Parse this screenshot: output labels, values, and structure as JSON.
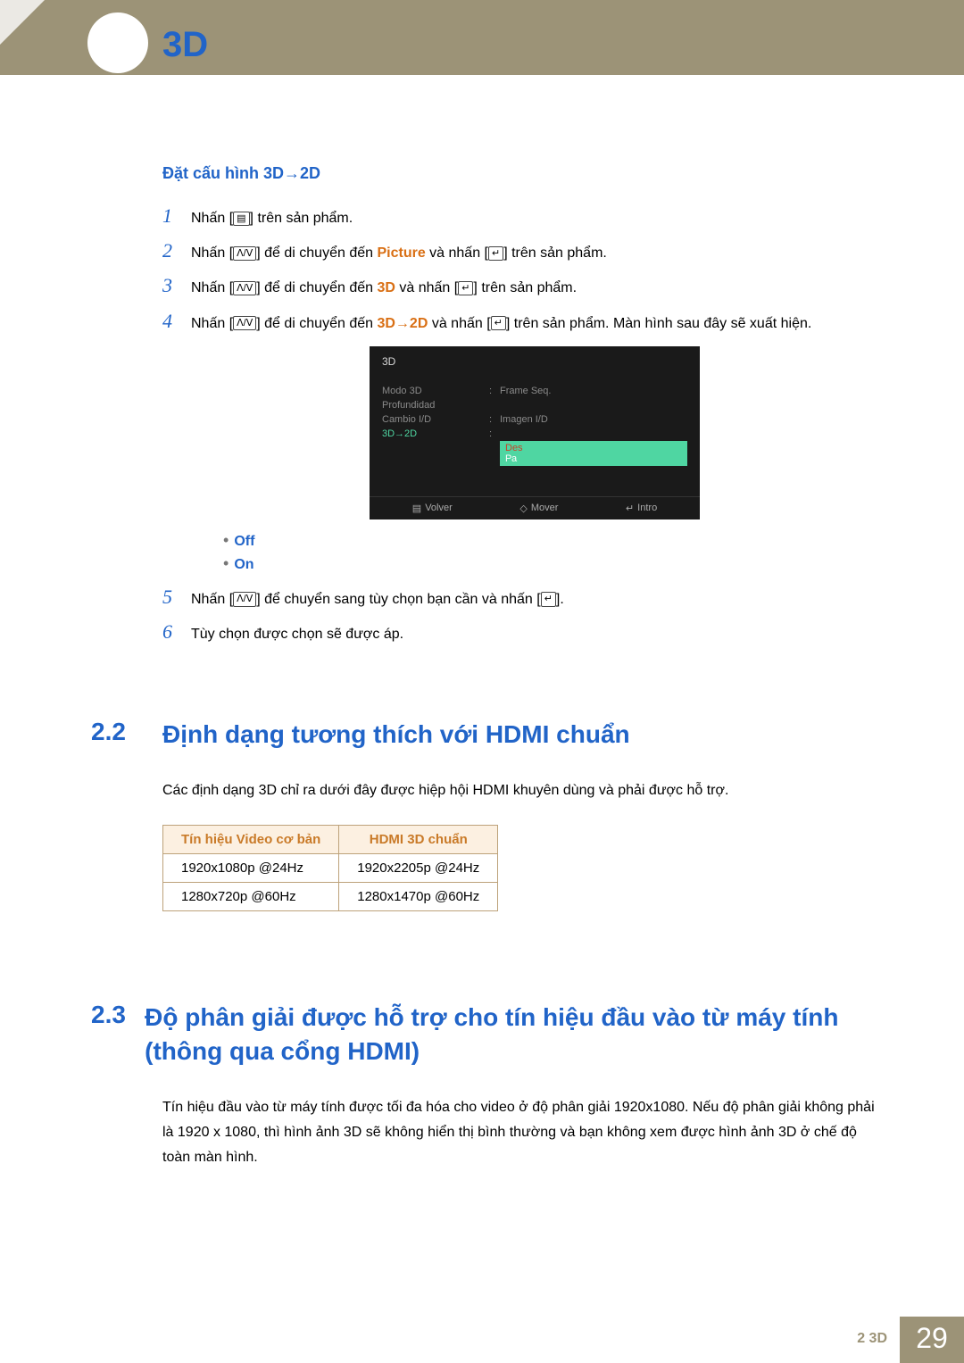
{
  "header": {
    "title": "3D"
  },
  "subhead": "Đặt cấu hình 3D→2D",
  "steps": {
    "s1": {
      "text_a": "Nhấn [",
      "text_b": "] trên sản phẩm."
    },
    "s2": {
      "text_a": "Nhấn [",
      "text_b": "] để di chuyển đến ",
      "kw": "Picture",
      "text_c": " và nhấn [",
      "text_d": "] trên sản phẩm."
    },
    "s3": {
      "text_a": "Nhấn [",
      "text_b": "] để di chuyển đến ",
      "kw": "3D",
      "text_c": " và nhấn [",
      "text_d": "] trên sản phẩm."
    },
    "s4": {
      "text_a": "Nhấn [",
      "text_b": "] để di chuyển đến ",
      "kw": "3D→2D",
      "text_c": " và nhấn [",
      "text_d": "] trên sản phẩm. Màn hình sau đây sẽ xuất hiện."
    },
    "s5": {
      "text_a": "Nhấn [",
      "text_b": "] để chuyển sang tùy chọn bạn cần và nhấn [",
      "text_c": "]."
    },
    "s6": {
      "text": "Tùy chọn được chọn sẽ được áp."
    }
  },
  "osd": {
    "title": "3D",
    "rows": {
      "r1": {
        "label": "Modo 3D",
        "value": "Frame Seq."
      },
      "r2": {
        "label": "Profundidad",
        "value": ""
      },
      "r3": {
        "label": "Cambio I/D",
        "value": "Imagen I/D"
      },
      "r4": {
        "label": "3D→2D"
      }
    },
    "dropdown": {
      "off": "Des",
      "on": "Ра"
    },
    "footer": {
      "back": "Volver",
      "move": "Mover",
      "enter": "Intro"
    }
  },
  "options": {
    "off": "Off",
    "on": "On"
  },
  "section22": {
    "num": "2.2",
    "title": "Định dạng tương thích với HDMI chuẩn",
    "para": "Các định dạng 3D chỉ ra dưới đây được hiệp hội HDMI khuyên dùng và phải được hỗ trợ.",
    "chart_data": {
      "type": "table",
      "headers": [
        "Tín hiệu Video cơ bản",
        "HDMI 3D chuẩn"
      ],
      "rows": [
        [
          "1920x1080p @24Hz",
          "1920x2205p @24Hz"
        ],
        [
          "1280x720p @60Hz",
          "1280x1470p @60Hz"
        ]
      ]
    }
  },
  "section23": {
    "num": "2.3",
    "title": "Độ phân giải được hỗ trợ cho tín hiệu đầu vào từ máy tính (thông qua cổng HDMI)",
    "para": "Tín hiệu đầu vào từ máy tính được tối đa hóa cho video ở độ phân giải 1920x1080. Nếu độ phân giải không phải là 1920 x 1080, thì hình ảnh 3D sẽ không hiển thị bình thường và bạn không xem được hình ảnh 3D ở chế độ toàn màn hình."
  },
  "footer": {
    "label": "2 3D",
    "page": "29"
  }
}
